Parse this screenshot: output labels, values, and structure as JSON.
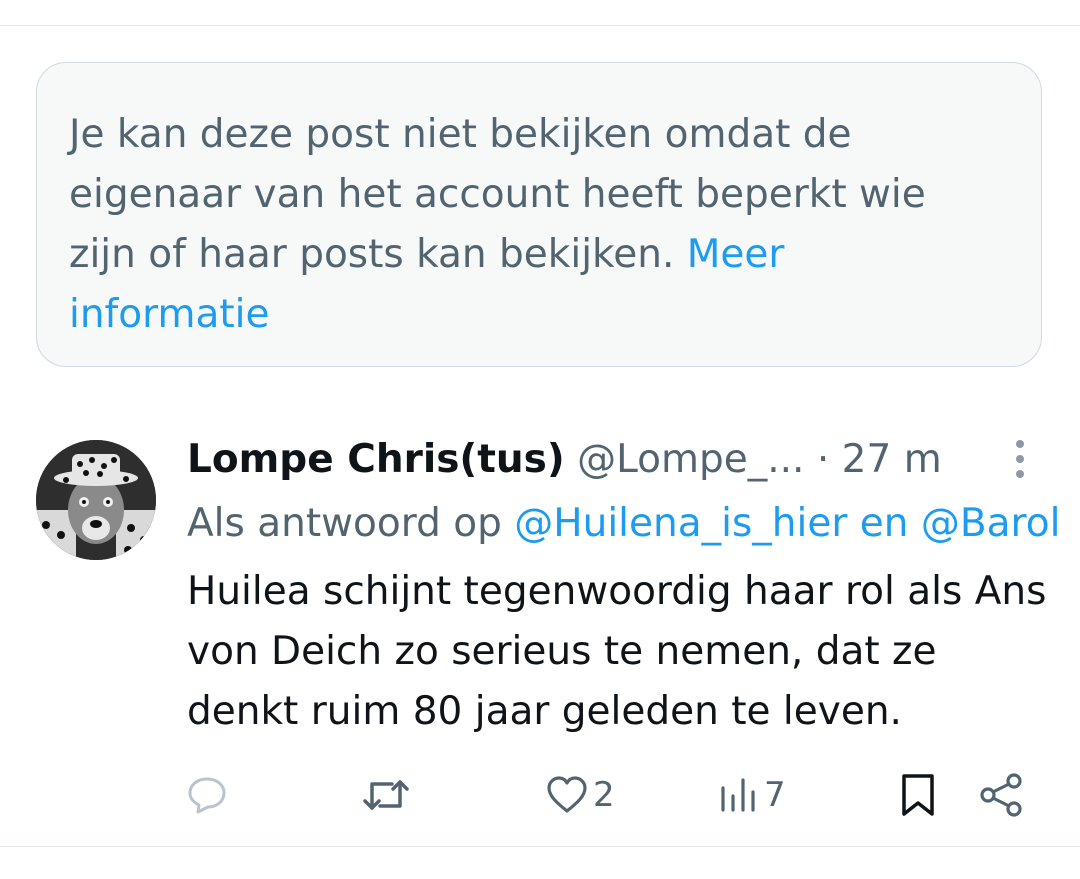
{
  "notice": {
    "text": "Je kan deze post niet bekijken omdat de eigenaar van het account heeft beperkt wie zijn of haar posts kan bekijken.",
    "link": "Meer informatie"
  },
  "post": {
    "display_name": "Lompe Chris(tus)",
    "handle": "@Lompe_...",
    "separator": "·",
    "time": "27 m",
    "reply_prefix": "Als antwoord op",
    "reply_user_1": "@Huilena_is_hier",
    "reply_conj": "en",
    "reply_user_2": "@Barol",
    "text": "Huilea schijnt tegenwoordig haar rol als Ans von Deich zo serieus te nemen, dat ze denkt ruim 80 jaar geleden te leven."
  },
  "actions": {
    "reply_icon": "reply-icon",
    "repost_icon": "repost-icon",
    "like_icon": "heart-icon",
    "like_count": "2",
    "views_icon": "views-icon",
    "views_count": "7",
    "bookmark_icon": "bookmark-icon",
    "share_icon": "share-icon"
  },
  "colors": {
    "link": "#1d9bf0",
    "secondary_text": "#536471",
    "notice_bg": "#f7f9f9"
  }
}
